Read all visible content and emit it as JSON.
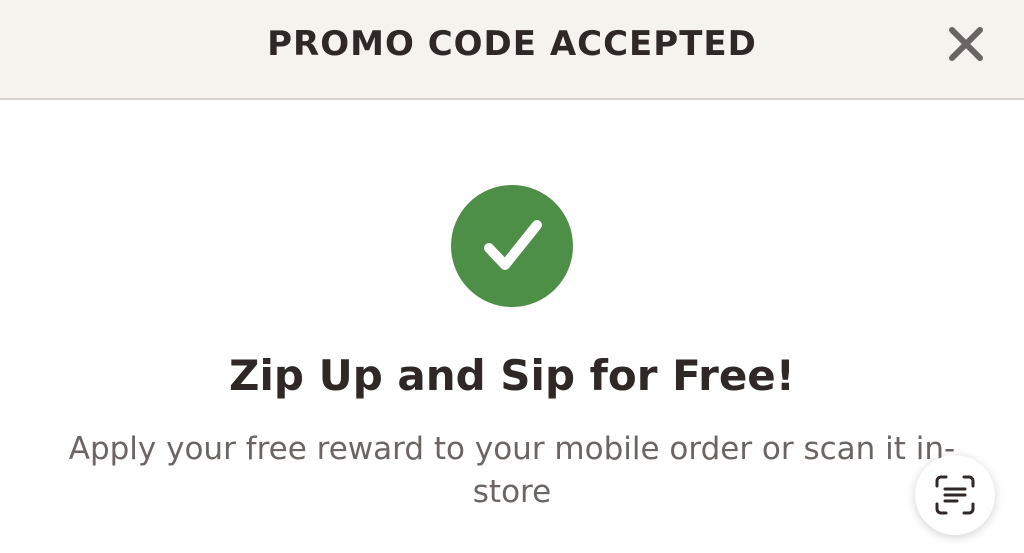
{
  "header": {
    "title": "PROMO CODE ACCEPTED",
    "close_icon": "close-icon"
  },
  "status": {
    "icon": "checkmark-icon",
    "color": "#4e8f47"
  },
  "message": {
    "headline": "Zip Up and Sip for Free!",
    "body": "Apply your free reward to your mobile order or scan it in-store"
  },
  "scan_button": {
    "icon": "scan-text-icon"
  },
  "colors": {
    "header_bg": "#f6f3ef",
    "text_dark": "#2f2826",
    "text_muted": "#6b6663",
    "success": "#4e8f47"
  }
}
